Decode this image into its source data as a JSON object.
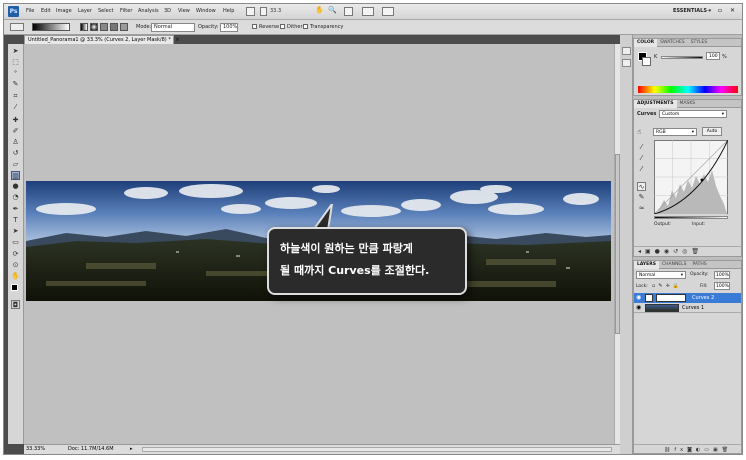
{
  "menubar": {
    "logo": "Ps",
    "items": [
      "File",
      "Edit",
      "Image",
      "Layer",
      "Select",
      "Filter",
      "Analysis",
      "3D",
      "View",
      "Window",
      "Help"
    ],
    "zoom": "33.3",
    "workspace": "ESSENTIALS ▾",
    "window_controls": "– ▫ ✕"
  },
  "options": {
    "mode_label": "Mode:",
    "mode_value": "Normal",
    "opacity_label": "Opacity:",
    "opacity_value": "100%",
    "reverse": "Reverse",
    "dither": "Dither",
    "transparency": "Transparency"
  },
  "document": {
    "tab_title": "Untitled_Panorama1 @ 33.3% (Curves 2, Layer Mask/8) *",
    "close": "×"
  },
  "callout": {
    "line1": "하늘색이 원하는 만큼 파랑게",
    "line2": "될 때까지 Curves를 조절한다."
  },
  "status": {
    "zoom": "33.33%",
    "doc": "Doc: 11.7M/14.6M"
  },
  "color_panel": {
    "tabs": [
      "COLOR",
      "SWATCHES",
      "STYLES"
    ],
    "k_label": "K",
    "k_value": "100",
    "k_unit": "%"
  },
  "adjustments_panel": {
    "tabs": [
      "ADJUSTMENTS",
      "MASKS"
    ],
    "title": "Curves",
    "preset": "Custom",
    "channel": "RGB",
    "auto": "Auto",
    "output_label": "Output:",
    "input_label": "Input:"
  },
  "layers_panel": {
    "tabs": [
      "LAYERS",
      "CHANNELS",
      "PATHS"
    ],
    "blend": "Normal",
    "opacity_label": "Opacity:",
    "opacity_value": "100%",
    "lock_label": "Lock:",
    "fill_label": "Fill:",
    "fill_value": "100%",
    "layers": [
      {
        "name": "Curves 2",
        "selected": true
      },
      {
        "name": "Curves 1",
        "selected": false
      }
    ]
  },
  "colors": {
    "accent": "#3a7bd5",
    "callout_bg": "#2b2b2b",
    "canvas": "#c0c0c0"
  }
}
